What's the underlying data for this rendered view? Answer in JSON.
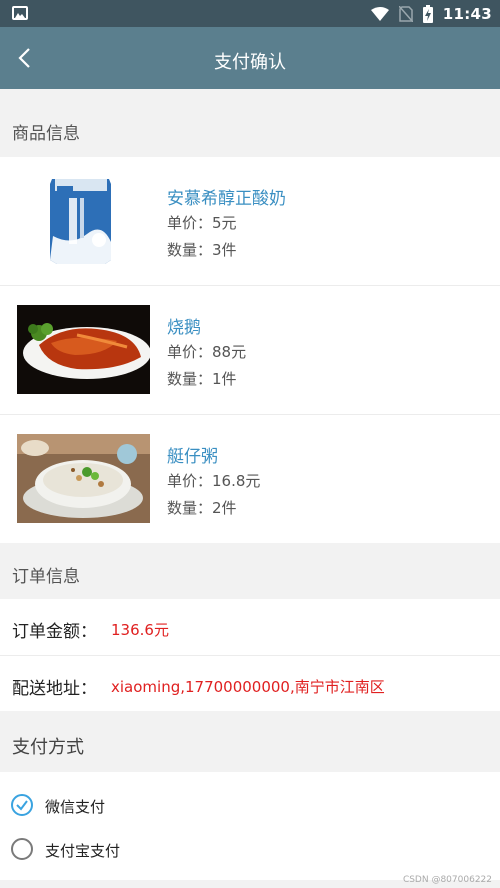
{
  "status_bar": {
    "time": "11:43"
  },
  "app_bar": {
    "title": "支付确认"
  },
  "goods_section": {
    "heading": "商品信息",
    "items": [
      {
        "name": "安慕希醇正酸奶",
        "price": "单价：5元",
        "qty": "数量：3件"
      },
      {
        "name": "烧鹅",
        "price": "单价：88元",
        "qty": "数量：1件"
      },
      {
        "name": "艇仔粥",
        "price": "单价：16.8元",
        "qty": "数量：2件"
      }
    ]
  },
  "order_section": {
    "heading": "订单信息",
    "amount_label": "订单金额：",
    "amount_value": "136.6元",
    "address_label": "配送地址：",
    "address_value": "xiaoming,17700000000,南宁市江南区"
  },
  "pay_section": {
    "heading": "支付方式",
    "options": [
      {
        "label": "微信支付",
        "checked": true
      },
      {
        "label": "支付宝支付",
        "checked": false
      }
    ]
  },
  "watermark": "CSDN @807006222",
  "colors": {
    "app_bar": "#5b7f8e",
    "status_bar": "#3f5560",
    "link": "#3a8fc2",
    "accent_red": "#e02020",
    "radio_checked": "#3aa3e0"
  }
}
